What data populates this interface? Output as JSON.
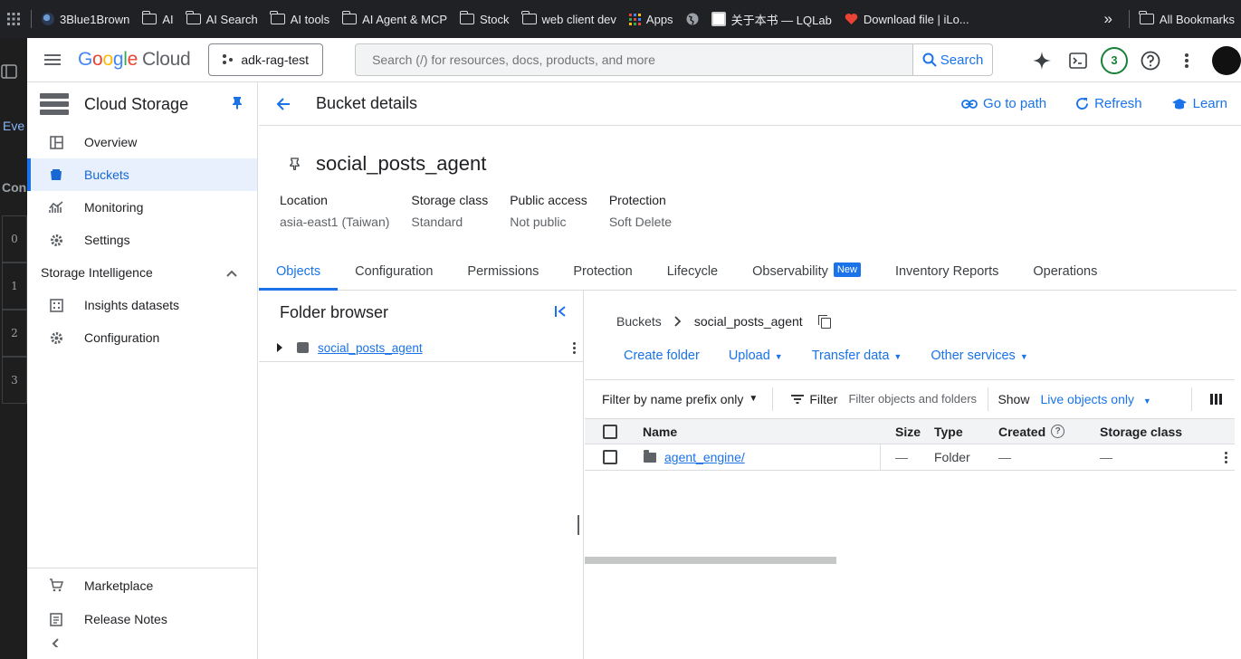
{
  "bookmarks": [
    {
      "label": "3Blue1Brown",
      "icon": "3b1b-icon"
    },
    {
      "label": "AI",
      "icon": "folder-icon"
    },
    {
      "label": "AI Search",
      "icon": "folder-icon"
    },
    {
      "label": "AI tools",
      "icon": "folder-icon"
    },
    {
      "label": "AI Agent & MCP",
      "icon": "folder-icon"
    },
    {
      "label": "Stock",
      "icon": "folder-icon"
    },
    {
      "label": "web client dev",
      "icon": "folder-icon"
    },
    {
      "label": "Apps",
      "icon": "apps-grid-icon"
    },
    {
      "label": "",
      "icon": "globe-icon"
    },
    {
      "label": "关于本书 — LQLab",
      "icon": "site-icon"
    },
    {
      "label": "Download file | iLo...",
      "icon": "heart-icon"
    }
  ],
  "bookmarks_more": "»",
  "all_bookmarks": "All Bookmarks",
  "side_strip": {
    "eve": "Eve",
    "con": "Con",
    "rows": [
      "0",
      "1",
      "2",
      "3"
    ]
  },
  "header": {
    "logo": {
      "google": [
        "G",
        "o",
        "o",
        "g",
        "l",
        "e"
      ],
      "cloud": "Cloud"
    },
    "project": "adk-rag-test",
    "search_placeholder": "Search (/) for resources, docs, products, and more",
    "search_button": "Search",
    "notifications_count": "3"
  },
  "sidebar": {
    "product": "Cloud Storage",
    "items": [
      {
        "label": "Overview",
        "icon": "dashboard-icon"
      },
      {
        "label": "Buckets",
        "icon": "bucket-icon",
        "active": true
      },
      {
        "label": "Monitoring",
        "icon": "chart-icon"
      },
      {
        "label": "Settings",
        "icon": "gear-icon"
      }
    ],
    "section": "Storage Intelligence",
    "section_items": [
      {
        "label": "Insights datasets",
        "icon": "dataset-icon"
      },
      {
        "label": "Configuration",
        "icon": "gear-icon"
      }
    ],
    "bottom": [
      {
        "label": "Marketplace",
        "icon": "cart-icon"
      },
      {
        "label": "Release Notes",
        "icon": "notes-icon"
      }
    ]
  },
  "main": {
    "title": "Bucket details",
    "actions": {
      "go_to_path": "Go to path",
      "refresh": "Refresh",
      "learn": "Learn"
    },
    "bucket": "social_posts_agent",
    "props": [
      {
        "key": "Location",
        "value": "asia-east1 (Taiwan)"
      },
      {
        "key": "Storage class",
        "value": "Standard"
      },
      {
        "key": "Public access",
        "value": "Not public"
      },
      {
        "key": "Protection",
        "value": "Soft Delete"
      }
    ],
    "tabs": [
      "Objects",
      "Configuration",
      "Permissions",
      "Protection",
      "Lifecycle",
      "Observability",
      "Inventory Reports",
      "Operations"
    ],
    "new_badge": "New"
  },
  "folder_browser": {
    "title": "Folder browser",
    "root": "social_posts_agent"
  },
  "objects": {
    "crumb_root": "Buckets",
    "crumb_current": "social_posts_agent",
    "actions": [
      "Create folder",
      "Upload",
      "Transfer data",
      "Other services"
    ],
    "filter_prefix": "Filter by name prefix only",
    "filter_label": "Filter",
    "filter_placeholder": "Filter objects and folders",
    "show_label": "Show",
    "show_value": "Live objects only",
    "columns": [
      "Name",
      "Size",
      "Type",
      "Created",
      "Storage class"
    ],
    "rows": [
      {
        "name": "agent_engine/",
        "size": "—",
        "type": "Folder",
        "created": "—",
        "storage_class": "—"
      }
    ]
  }
}
